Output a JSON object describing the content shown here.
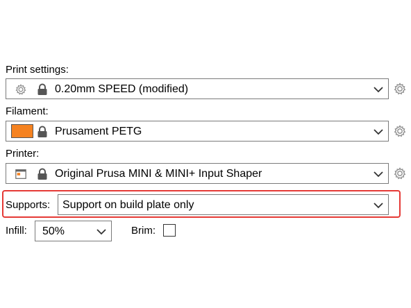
{
  "print_settings": {
    "label": "Print settings:",
    "value": "0.20mm SPEED (modified)",
    "preset_icon": "gear-icon",
    "lock_icon": "lock-icon"
  },
  "filament": {
    "label": "Filament:",
    "value": "Prusament PETG",
    "color": "#f58220",
    "lock_icon": "lock-icon"
  },
  "printer": {
    "label": "Printer:",
    "value": "Original Prusa MINI & MINI+ Input Shaper",
    "preset_icon": "printer-icon",
    "lock_icon": "lock-icon"
  },
  "supports": {
    "label": "Supports:",
    "value": "Support on build plate only",
    "highlight_color": "#e53935"
  },
  "infill": {
    "label": "Infill:",
    "value": "50%"
  },
  "brim": {
    "label": "Brim:",
    "checked": false
  }
}
